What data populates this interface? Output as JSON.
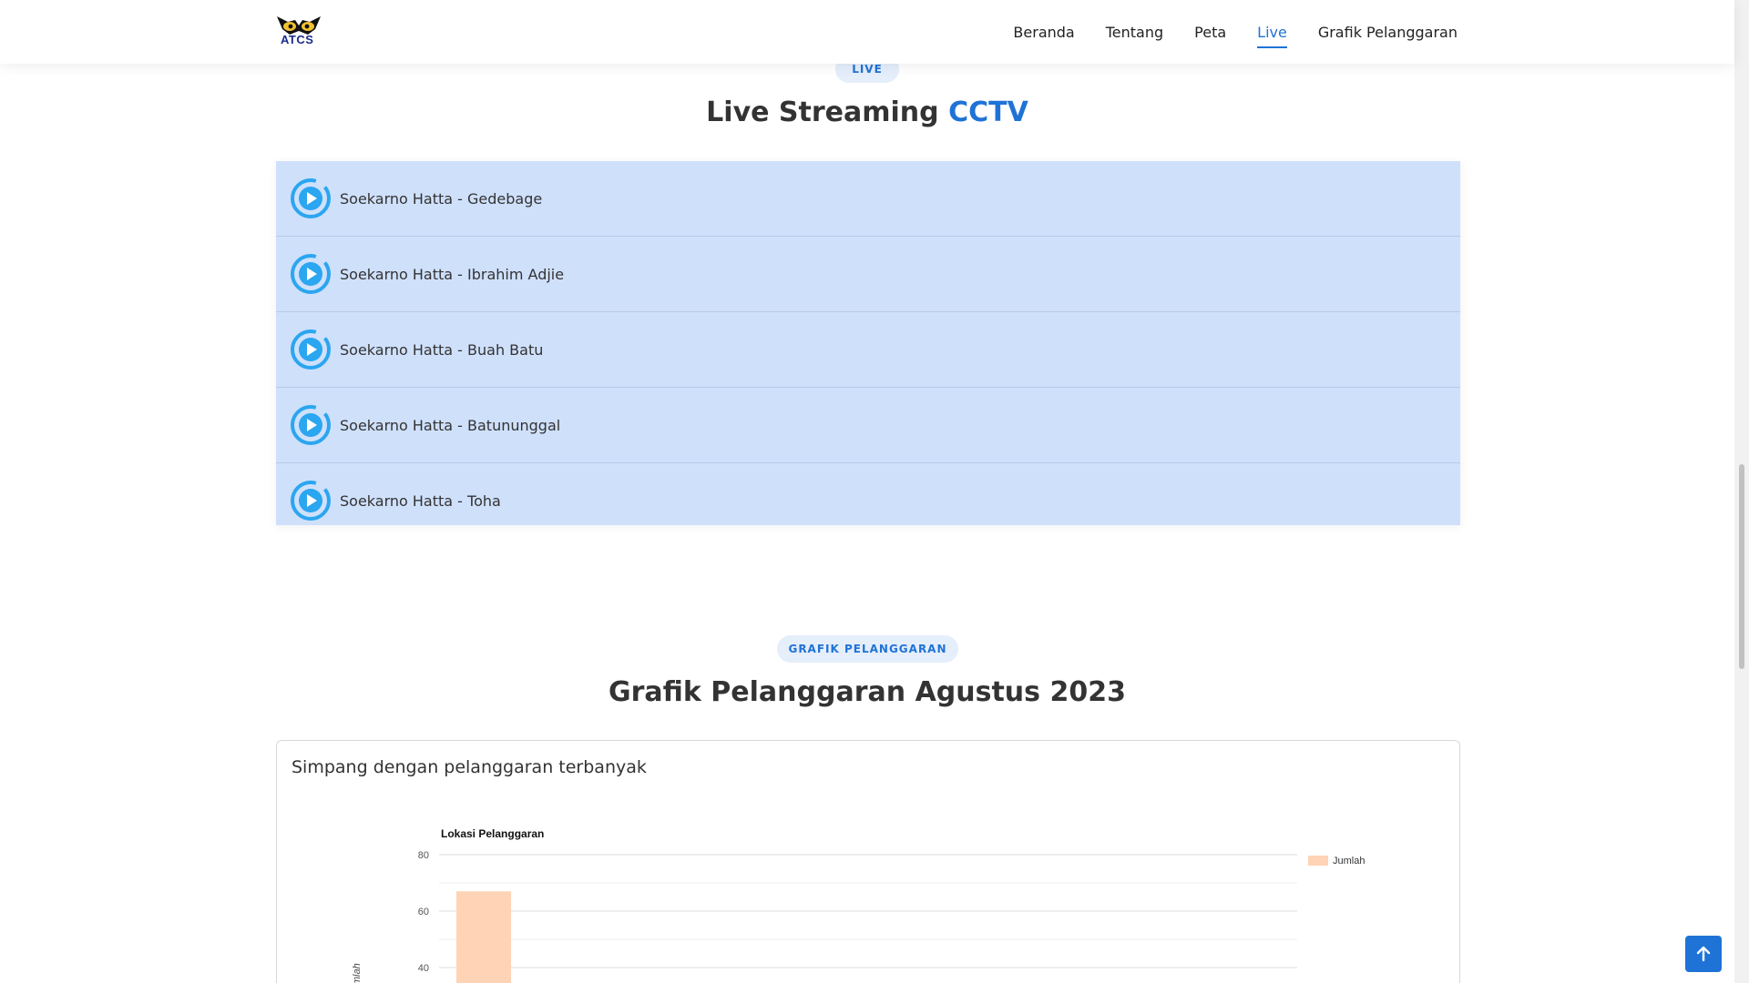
{
  "header": {
    "logo_text": "ATCS",
    "nav": [
      {
        "label": "Beranda"
      },
      {
        "label": "Tentang"
      },
      {
        "label": "Peta"
      },
      {
        "label": "Live",
        "active": true
      },
      {
        "label": "Grafik Pelanggaran"
      }
    ]
  },
  "live_section": {
    "tag": "LIVE",
    "title_main": "Live Streaming",
    "title_accent": "CCTV",
    "items": [
      {
        "label": "Soekarno Hatta - Gedebage"
      },
      {
        "label": "Soekarno Hatta - Ibrahim Adjie"
      },
      {
        "label": "Soekarno Hatta - Buah Batu"
      },
      {
        "label": "Soekarno Hatta - Batununggal"
      },
      {
        "label": "Soekarno Hatta - Toha"
      }
    ]
  },
  "chart_section": {
    "tag": "GRAFIK PELANGGARAN",
    "title": "Grafik Pelanggaran Agustus 2023",
    "card_title": "Simpang dengan pelanggaran terbanyak"
  },
  "chart_data": {
    "type": "bar",
    "title": "Lokasi Pelanggaran",
    "ylabel": "Jumlah",
    "xlabel": "",
    "legend": "top-right",
    "grid": true,
    "ylim": [
      0,
      80
    ],
    "yticks": [
      40,
      60,
      80
    ],
    "series": [
      {
        "name": "Jumlah",
        "values": [
          67
        ]
      }
    ],
    "bar_color": "#ffd3b5"
  },
  "colors": {
    "accent": "#1f73d6",
    "list_bg": "#cfe0fb",
    "tag_bg": "#e5eefb"
  },
  "icons": {
    "play": "play-circle-icon",
    "back_top": "arrow-up-icon",
    "logo": "owl-eyes-logo"
  }
}
